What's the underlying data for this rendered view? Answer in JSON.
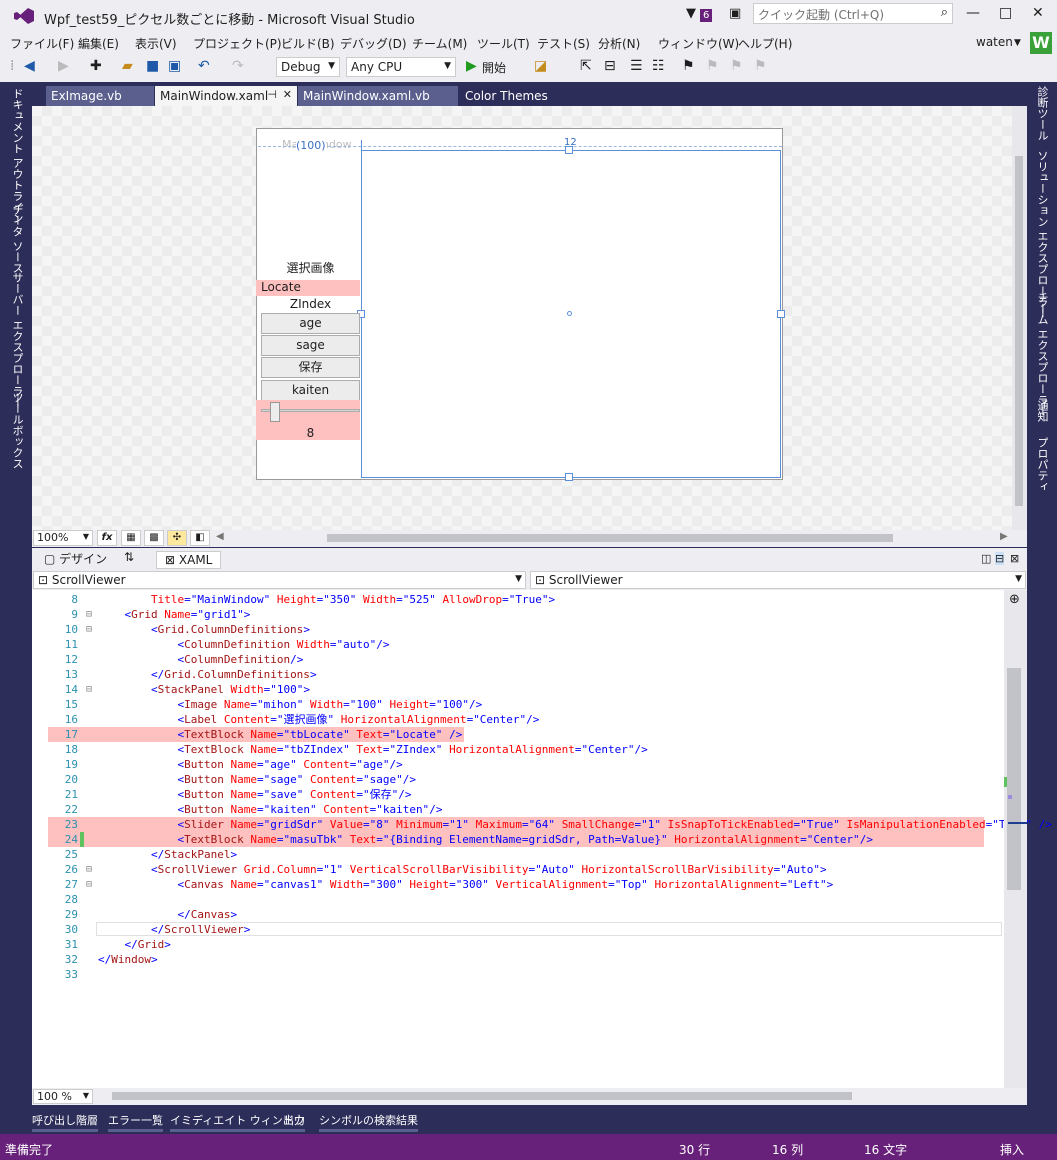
{
  "window": {
    "title": "Wpf_test59_ピクセル数ごとに移動 - Microsoft Visual Studio",
    "notification_count": "6",
    "quick_launch_placeholder": "クイック起動 (Ctrl+Q)",
    "min_icon": "—",
    "max_icon": "□",
    "close_icon": "✕"
  },
  "menu": [
    "ファイル(F)",
    "編集(E)",
    "表示(V)",
    "プロジェクト(P)",
    "ビルド(B)",
    "デバッグ(D)",
    "チーム(M)",
    "ツール(T)",
    "テスト(S)",
    "分析(N)",
    "ウィンドウ(W)",
    "ヘルプ(H)"
  ],
  "account": {
    "user": "waten",
    "avatar_letter": "W"
  },
  "toolbar": {
    "config": "Debug",
    "platform": "Any CPU",
    "start": "開始"
  },
  "left_rail": [
    "ドキュメント アウトライン",
    "データ ソース",
    "サーバー エクスプローラー",
    "ツールボックス"
  ],
  "right_rail": [
    "診断ツール",
    "ソリューション エクスプローラー",
    "チーム エクスプローラー",
    "通知",
    "プロパティ"
  ],
  "doc_tabs": [
    {
      "label": "ExImage.vb",
      "active": false
    },
    {
      "label": "MainWindow.xaml",
      "active": true
    },
    {
      "label": "MainWindow.xaml.vb",
      "active": false
    },
    {
      "label": "Color Themes",
      "active": false
    }
  ],
  "designer": {
    "window_title": "MainWindow",
    "column_marker": "(100)",
    "top_marker": "12",
    "label": "選択画像",
    "tb_locate": "Locate",
    "tb_zindex": "ZIndex",
    "buttons": [
      "age",
      "sage",
      "保存",
      "kaiten"
    ],
    "slider_value": "8",
    "zoom": "100%"
  },
  "split_tabs": {
    "design": "デザイン",
    "swap": "⇅",
    "xaml": "XAML"
  },
  "nav": {
    "left": "ScrollViewer",
    "right": "ScrollViewer"
  },
  "code_lines": [
    {
      "n": "8",
      "t": "        Title=\"MainWindow\" Height=\"350\" Width=\"525\" AllowDrop=\"True\">"
    },
    {
      "n": "9",
      "t": "    <Grid Name=\"grid1\">"
    },
    {
      "n": "10",
      "t": "        <Grid.ColumnDefinitions>"
    },
    {
      "n": "11",
      "t": "            <ColumnDefinition Width=\"auto\"/>"
    },
    {
      "n": "12",
      "t": "            <ColumnDefinition/>"
    },
    {
      "n": "13",
      "t": "        </Grid.ColumnDefinitions>"
    },
    {
      "n": "14",
      "t": "        <StackPanel Width=\"100\">"
    },
    {
      "n": "15",
      "t": "            <Image Name=\"mihon\" Width=\"100\" Height=\"100\"/>"
    },
    {
      "n": "16",
      "t": "            <Label Content=\"選択画像\" HorizontalAlignment=\"Center\"/>"
    },
    {
      "n": "17",
      "t": "            <TextBlock Name=\"tbLocate\" Text=\"Locate\" />"
    },
    {
      "n": "18",
      "t": "            <TextBlock Name=\"tbZIndex\" Text=\"ZIndex\" HorizontalAlignment=\"Center\"/>"
    },
    {
      "n": "19",
      "t": "            <Button Name=\"age\" Content=\"age\"/>"
    },
    {
      "n": "20",
      "t": "            <Button Name=\"sage\" Content=\"sage\"/>"
    },
    {
      "n": "21",
      "t": "            <Button Name=\"save\" Content=\"保存\"/>"
    },
    {
      "n": "22",
      "t": "            <Button Name=\"kaiten\" Content=\"kaiten\"/>"
    },
    {
      "n": "23",
      "t": "            <Slider Name=\"gridSdr\" Value=\"8\" Minimum=\"1\" Maximum=\"64\" SmallChange=\"1\" IsSnapToTickEnabled=\"True\" IsManipulationEnabled=\"True\" />"
    },
    {
      "n": "24",
      "t": "            <TextBlock Name=\"masuTbk\" Text=\"{Binding ElementName=gridSdr, Path=Value}\" HorizontalAlignment=\"Center\"/>"
    },
    {
      "n": "25",
      "t": "        </StackPanel>"
    },
    {
      "n": "26",
      "t": "        <ScrollViewer Grid.Column=\"1\" VerticalScrollBarVisibility=\"Auto\" HorizontalScrollBarVisibility=\"Auto\">"
    },
    {
      "n": "27",
      "t": "            <Canvas Name=\"canvas1\" Width=\"300\" Height=\"300\" VerticalAlignment=\"Top\" HorizontalAlignment=\"Left\">"
    },
    {
      "n": "28",
      "t": ""
    },
    {
      "n": "29",
      "t": "            </Canvas>"
    },
    {
      "n": "30",
      "t": "        </ScrollViewer>"
    },
    {
      "n": "31",
      "t": "    </Grid>"
    },
    {
      "n": "32",
      "t": "</Window>"
    },
    {
      "n": "33",
      "t": ""
    }
  ],
  "editor_zoom": "100 %",
  "bottom_tabs": [
    "呼び出し階層",
    "エラー一覧",
    "イミディエイト ウィンドウ",
    "出力",
    "シンボルの検索結果"
  ],
  "status": {
    "ready": "準備完了",
    "line": "30 行",
    "col": "16 列",
    "char": "16 文字",
    "mode": "挿入"
  },
  "colors": {
    "accent": "#68217a",
    "frame": "#2d2d5a",
    "highlight": "#ffc0c0"
  }
}
